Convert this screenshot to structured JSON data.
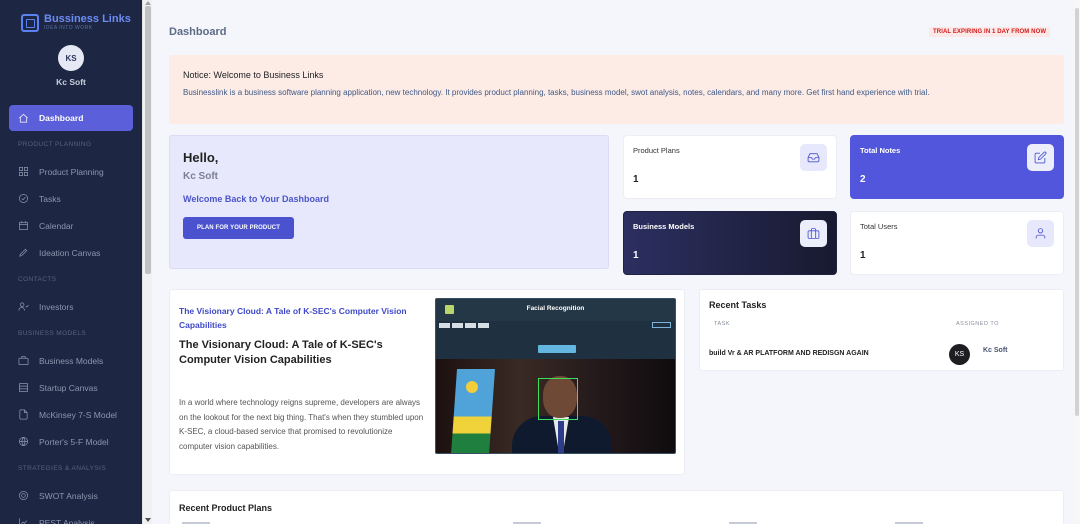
{
  "brand": {
    "name": "Bussiness Links",
    "tagline": "IDEA INTO WORK"
  },
  "user": {
    "initials": "KS",
    "name": "Kc Soft"
  },
  "sidebar": {
    "items": [
      {
        "type": "item",
        "label": "Dashboard",
        "icon": "home-icon",
        "active": true
      },
      {
        "type": "section",
        "label": "PRODUCT PLANNING"
      },
      {
        "type": "item",
        "label": "Product Planning",
        "icon": "grid-icon"
      },
      {
        "type": "item",
        "label": "Tasks",
        "icon": "check-circle-icon"
      },
      {
        "type": "item",
        "label": "Calendar",
        "icon": "calendar-icon"
      },
      {
        "type": "item",
        "label": "Ideation Canvas",
        "icon": "pen-icon"
      },
      {
        "type": "section",
        "label": "CONTACTS"
      },
      {
        "type": "item",
        "label": "Investors",
        "icon": "users-icon"
      },
      {
        "type": "section",
        "label": "BUSINESS MODELS"
      },
      {
        "type": "item",
        "label": "Business Models",
        "icon": "briefcase-icon"
      },
      {
        "type": "item",
        "label": "Startup Canvas",
        "icon": "layout-icon"
      },
      {
        "type": "item",
        "label": "McKinsey 7-S Model",
        "icon": "file-icon"
      },
      {
        "type": "item",
        "label": "Porter's 5-F Model",
        "icon": "globe-icon"
      },
      {
        "type": "section",
        "label": "STRATEGIES & ANALYSIS"
      },
      {
        "type": "item",
        "label": "SWOT Analysis",
        "icon": "target-icon"
      },
      {
        "type": "item",
        "label": "PEST Analysis",
        "icon": "chart-icon"
      }
    ]
  },
  "header": {
    "title": "Dashboard",
    "trial_badge": "TRIAL EXPIRING IN 1 DAY FROM NOW"
  },
  "notice": {
    "title": "Notice: Welcome to Business Links",
    "text": "Businesslink is a business software planning application, new technology. It provides product planning, tasks, business model, swot analysis, notes, calendars, and many more. Get first hand experience with trial."
  },
  "hello": {
    "greeting": "Hello,",
    "name": "Kc Soft",
    "welcome": "Welcome Back to Your Dashboard",
    "button": "PLAN FOR YOUR PRODUCT"
  },
  "stats": {
    "product_plans": {
      "label": "Product Plans",
      "value": "1"
    },
    "total_notes": {
      "label": "Total Notes",
      "value": "2"
    },
    "business_models": {
      "label": "Business Models",
      "value": "1"
    },
    "total_users": {
      "label": "Total Users",
      "value": "1"
    }
  },
  "article": {
    "link": "The Visionary Cloud: A Tale of K-SEC's Computer Vision Capabilities",
    "title": "The Visionary Cloud: A Tale of K-SEC's Computer Vision Capabilities",
    "body": "In a world where technology reigns supreme, developers are always on the lookout for the next big thing. That's when they stumbled upon K-SEC, a cloud-based service that promised to revolutionize computer vision capabilities.",
    "image_title": "Facial Recognition"
  },
  "tasks": {
    "title": "Recent Tasks",
    "col_task": "TASK",
    "col_assigned": "ASSIGNED TO",
    "rows": [
      {
        "task": "build Vr & AR PLATFORM AND REDISGN AGAIN",
        "initials": "KS",
        "assignee": "Kc Soft"
      }
    ]
  },
  "recent_plans": {
    "title": "Recent Product Plans"
  },
  "colors": {
    "sidebar": "#1d2744",
    "accent": "#5256dc",
    "notice_bg": "#fdebe6",
    "trial_text": "#d01b1b"
  }
}
